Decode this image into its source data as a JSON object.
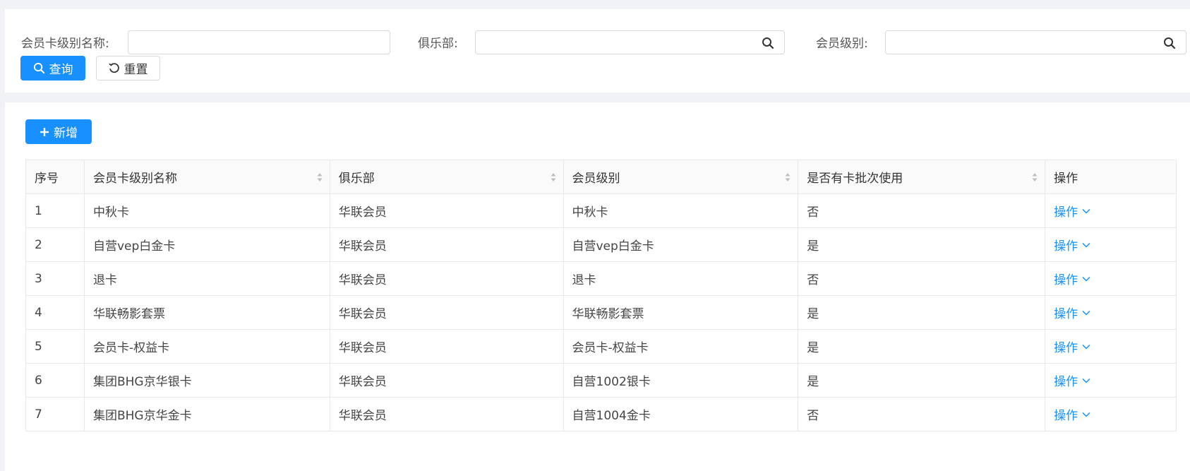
{
  "search": {
    "card_level_name_label": "会员卡级别名称:",
    "club_label": "俱乐部:",
    "member_level_label": "会员级别:",
    "query_label": "查询",
    "reset_label": "重置"
  },
  "toolbar": {
    "add_label": "新增"
  },
  "table": {
    "columns": [
      "序号",
      "会员卡级别名称",
      "俱乐部",
      "会员级别",
      "是否有卡批次使用",
      "操作"
    ],
    "rows": [
      {
        "index": "1",
        "name": "中秋卡",
        "club": "华联会员",
        "level": "中秋卡",
        "batch": "否",
        "action": "操作"
      },
      {
        "index": "2",
        "name": "自营vep白金卡",
        "club": "华联会员",
        "level": "自营vep白金卡",
        "batch": "是",
        "action": "操作"
      },
      {
        "index": "3",
        "name": "退卡",
        "club": "华联会员",
        "level": "退卡",
        "batch": "否",
        "action": "操作"
      },
      {
        "index": "4",
        "name": "华联畅影套票",
        "club": "华联会员",
        "level": "华联畅影套票",
        "batch": "是",
        "action": "操作"
      },
      {
        "index": "5",
        "name": "会员卡-权益卡",
        "club": "华联会员",
        "level": "会员卡-权益卡",
        "batch": "是",
        "action": "操作"
      },
      {
        "index": "6",
        "name": "集团BHG京华银卡",
        "club": "华联会员",
        "level": "自营1002银卡",
        "batch": "是",
        "action": "操作"
      },
      {
        "index": "7",
        "name": "集团BHG京华金卡",
        "club": "华联会员",
        "level": "自营1004金卡",
        "batch": "否",
        "action": "操作"
      }
    ]
  },
  "colors": {
    "primary": "#1890ff",
    "page_bg": "#f0f2f5",
    "border": "#e8e8e8"
  }
}
